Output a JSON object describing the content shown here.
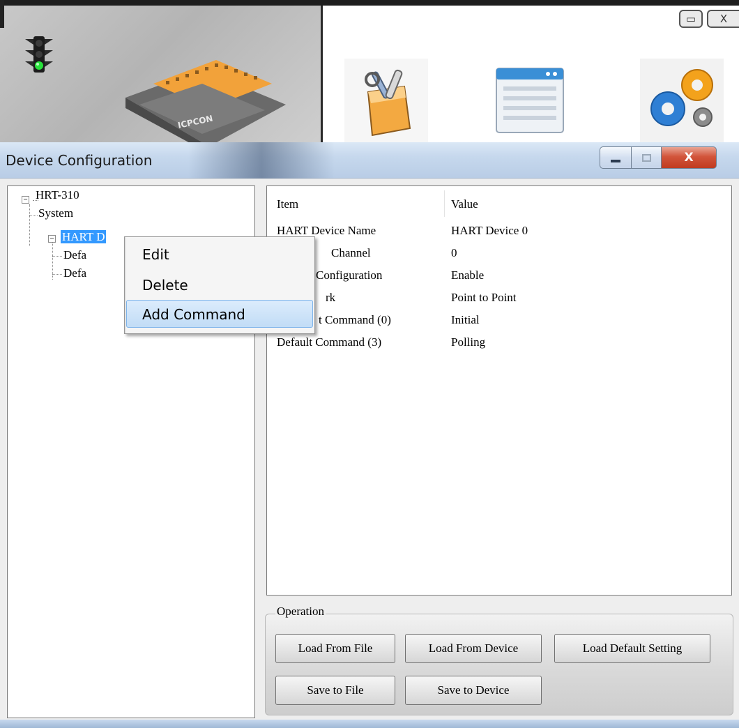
{
  "background_app": {
    "window_controls": {
      "minimize_glyph": "▭",
      "close_glyph": "X"
    },
    "icons": [
      "traffic-light-icon",
      "device-module-image",
      "tools-box-icon",
      "window-list-icon",
      "gears-icon"
    ],
    "module_label": "ICPCON"
  },
  "dialog": {
    "title": "Device Configuration",
    "controls": {
      "minimize": "minimize",
      "maximize": "maximize",
      "close": "X"
    }
  },
  "tree": {
    "root": "HRT-310",
    "children": [
      {
        "label": "System"
      },
      {
        "label": "HART Device 0",
        "selected": true,
        "children": [
          {
            "label": "Defa"
          },
          {
            "label": "Defa"
          }
        ]
      }
    ],
    "selected_visible_label": "HART D"
  },
  "listview": {
    "columns": {
      "item": "Item",
      "value": "Value"
    },
    "rows": [
      {
        "item": "HART Device Name",
        "value": "HART Device 0"
      },
      {
        "item": "Channel",
        "value": "0"
      },
      {
        "item": "Configuration",
        "value": "Enable"
      },
      {
        "item": "rk",
        "value": "Point to Point"
      },
      {
        "item": "t Command (0)",
        "value": "Initial"
      },
      {
        "item": "Default Command (3)",
        "value": "Polling"
      }
    ]
  },
  "operation": {
    "legend": "Operation",
    "buttons": {
      "load_from_file": "Load From File",
      "load_from_device": "Load From Device",
      "load_default_setting": "Load Default Setting",
      "save_to_file": "Save to File",
      "save_to_device": "Save to Device"
    }
  },
  "context_menu": {
    "items": [
      {
        "label": "Edit"
      },
      {
        "label": "Delete"
      },
      {
        "label": "Add Command",
        "highlighted": true
      }
    ]
  },
  "colors": {
    "selection": "#3399ff",
    "menu_highlight": "#c1dcf6",
    "titlebar": "#c6d8ed",
    "close_button": "#c03b20"
  }
}
